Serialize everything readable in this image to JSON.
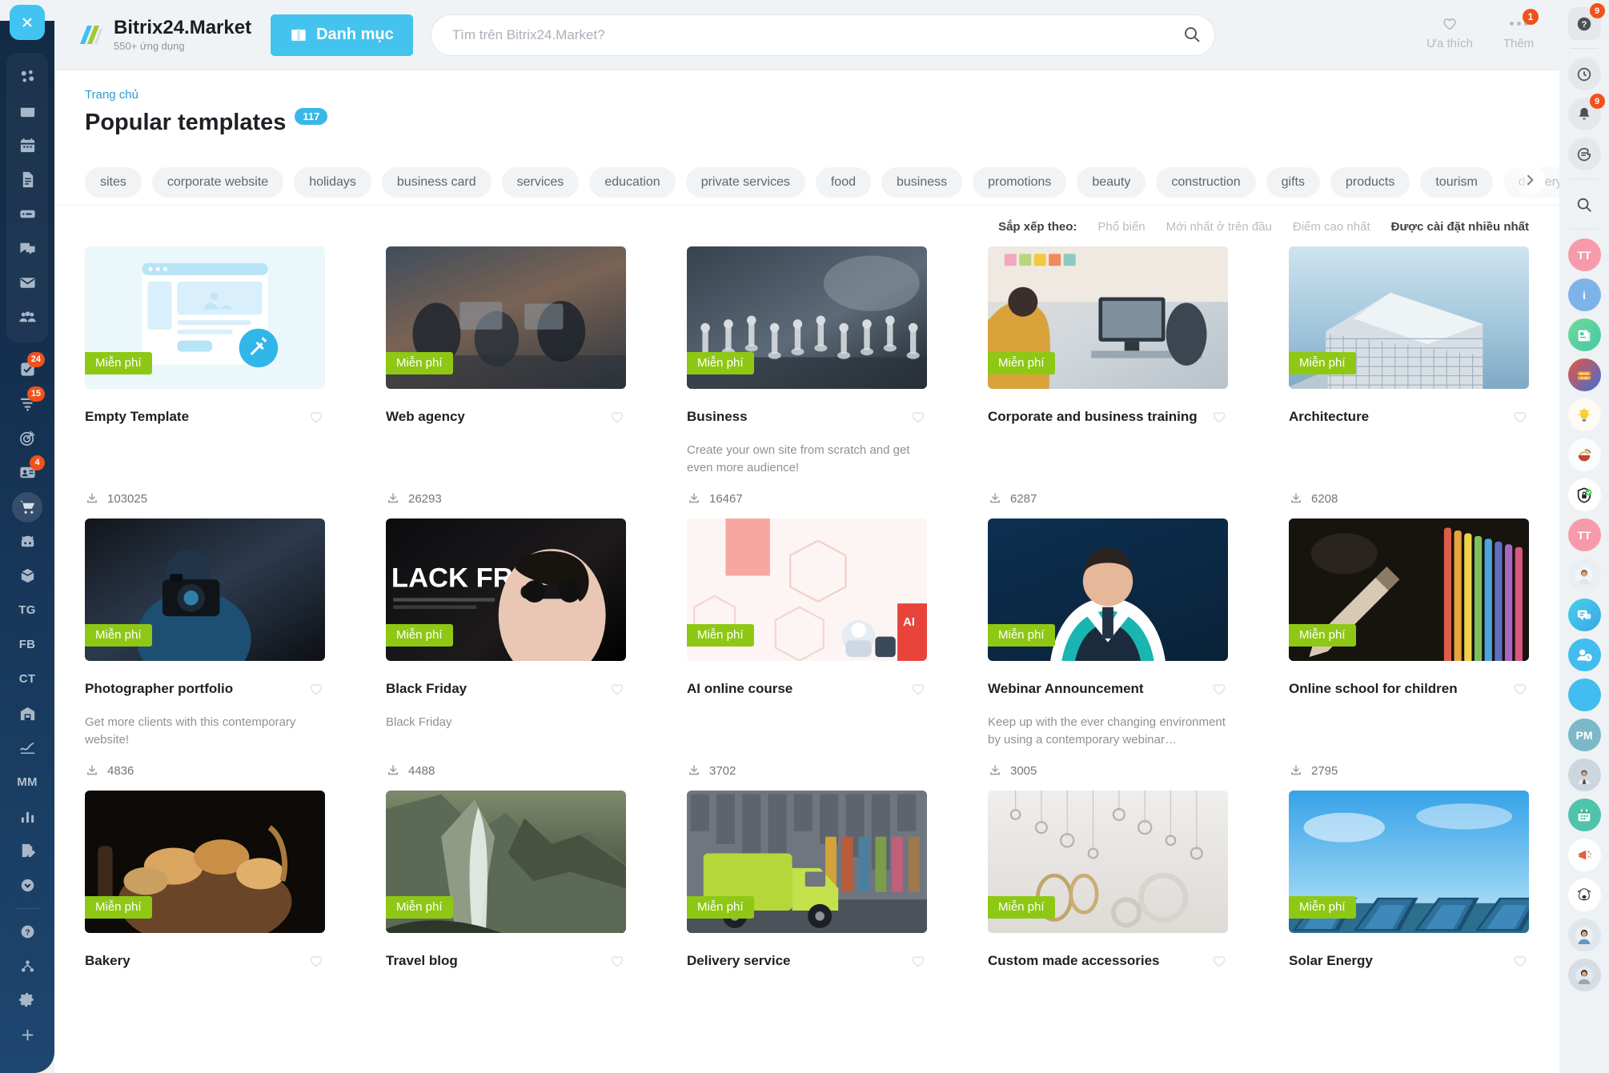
{
  "header": {
    "logo_title": "Bitrix24.Market",
    "logo_sub": "550+ ứng dụng",
    "catalog_button": "Danh mục",
    "search_placeholder": "Tìm trên Bitrix24.Market?",
    "search_value": "",
    "favorites_label": "Ưa thích",
    "more_label": "Thêm",
    "more_badge": "1"
  },
  "breadcrumb": {
    "home": "Trang chủ"
  },
  "page": {
    "title": "Popular templates",
    "count": "117"
  },
  "tags": [
    "sites",
    "corporate website",
    "holidays",
    "business card",
    "services",
    "education",
    "private services",
    "food",
    "business",
    "promotions",
    "beauty",
    "construction",
    "gifts",
    "products",
    "tourism",
    "delivery"
  ],
  "sort": {
    "label": "Sắp xếp theo:",
    "options": [
      {
        "label": "Phổ biến",
        "active": false
      },
      {
        "label": "Mới nhất ở trên đầu",
        "active": false
      },
      {
        "label": "Điểm cao nhất",
        "active": false
      },
      {
        "label": "Được cài đặt nhiều nhất",
        "active": true
      }
    ]
  },
  "free_badge": "Miễn phí",
  "cards": [
    {
      "title": "Empty Template",
      "desc": "",
      "downloads": "103025",
      "badge": "Miễn phí",
      "thumb": "empty-template"
    },
    {
      "title": "Web agency",
      "desc": "",
      "downloads": "26293",
      "badge": "Miễn phí",
      "thumb": "web-agency"
    },
    {
      "title": "Business",
      "desc": "Create your own site from scratch and get even more audience!",
      "downloads": "16467",
      "badge": "Miễn phí",
      "thumb": "business"
    },
    {
      "title": "Corporate and business training",
      "desc": "",
      "downloads": "6287",
      "badge": "Miễn phí",
      "thumb": "corporate-training"
    },
    {
      "title": "Architecture",
      "desc": "",
      "downloads": "6208",
      "badge": "Miễn phí",
      "thumb": "architecture"
    },
    {
      "title": "Photographer portfolio",
      "desc": "Get more clients with this contemporary website!",
      "downloads": "4836",
      "badge": "Miễn phí",
      "thumb": "photographer"
    },
    {
      "title": "Black Friday",
      "desc": "Black Friday",
      "downloads": "4488",
      "badge": "Miễn phí",
      "thumb": "black-friday"
    },
    {
      "title": "AI online course",
      "desc": "",
      "downloads": "3702",
      "badge": "Miễn phí",
      "thumb": "ai-course"
    },
    {
      "title": "Webinar Announcement",
      "desc": "Keep up with the ever changing environment by using a contemporary webinar…",
      "downloads": "3005",
      "badge": "Miễn phí",
      "thumb": "webinar"
    },
    {
      "title": "Online school for children",
      "desc": "",
      "downloads": "2795",
      "badge": "Miễn phí",
      "thumb": "online-school"
    },
    {
      "title": "Bakery",
      "desc": "",
      "downloads": "",
      "badge": "Miễn phí",
      "thumb": "bakery"
    },
    {
      "title": "Travel blog",
      "desc": "",
      "downloads": "",
      "badge": "Miễn phí",
      "thumb": "travel-blog"
    },
    {
      "title": "Delivery service",
      "desc": "",
      "downloads": "",
      "badge": "Miễn phí",
      "thumb": "delivery"
    },
    {
      "title": "Custom made accessories",
      "desc": "",
      "downloads": "",
      "badge": "Miễn phí",
      "thumb": "accessories"
    },
    {
      "title": "Solar Energy",
      "desc": "",
      "downloads": "",
      "badge": "Miễn phí",
      "thumb": "solar"
    }
  ],
  "left_sidebar": {
    "close_icon": "close-icon",
    "group": [
      {
        "name": "network-icon",
        "badge": ""
      },
      {
        "name": "feed-icon",
        "badge": ""
      },
      {
        "name": "calendar-icon",
        "badge": ""
      },
      {
        "name": "document-icon",
        "badge": ""
      },
      {
        "name": "drive-icon",
        "badge": ""
      },
      {
        "name": "chat-icon",
        "badge": ""
      },
      {
        "name": "mail-icon",
        "badge": ""
      },
      {
        "name": "group-icon",
        "badge": ""
      }
    ],
    "items": [
      {
        "name": "tasks-icon",
        "badge": "24",
        "text": ""
      },
      {
        "name": "funnel-icon",
        "badge": "15",
        "text": ""
      },
      {
        "name": "target-icon",
        "badge": "",
        "text": ""
      },
      {
        "name": "contacts-icon",
        "badge": "4",
        "text": ""
      },
      {
        "name": "market-cart-icon",
        "badge": "",
        "text": "",
        "active": true
      },
      {
        "name": "bot-icon",
        "badge": "",
        "text": ""
      },
      {
        "name": "box-icon",
        "badge": "",
        "text": ""
      },
      {
        "name": "tg-label",
        "badge": "",
        "text": "TG"
      },
      {
        "name": "fb-label",
        "badge": "",
        "text": "FB"
      },
      {
        "name": "ct-label",
        "badge": "",
        "text": "CT"
      },
      {
        "name": "warehouse-icon",
        "badge": "",
        "text": ""
      },
      {
        "name": "signature-icon",
        "badge": "",
        "text": ""
      },
      {
        "name": "mm-label",
        "badge": "",
        "text": "MM"
      },
      {
        "name": "analytics-icon",
        "badge": "",
        "text": ""
      },
      {
        "name": "report-edit-icon",
        "badge": "",
        "text": ""
      },
      {
        "name": "chevron-down-circle-icon",
        "badge": "",
        "text": ""
      }
    ],
    "bottom": [
      {
        "name": "help-circle-icon"
      },
      {
        "name": "sitemap-icon"
      },
      {
        "name": "gear-icon"
      },
      {
        "name": "plus-icon"
      }
    ]
  },
  "right_sidebar": {
    "items": [
      {
        "name": "help-question-icon",
        "badge": "9",
        "kind": "square-gray",
        "label": "?"
      },
      {
        "sep": true
      },
      {
        "name": "activity-icon",
        "badge": "",
        "kind": "circle-gray",
        "label": ""
      },
      {
        "name": "notifications-bell-icon",
        "badge": "9",
        "kind": "circle-gray",
        "label": ""
      },
      {
        "name": "chat-messages-icon",
        "badge": "",
        "kind": "circle-gray",
        "label": ""
      },
      {
        "sep": true
      },
      {
        "name": "search-icon",
        "badge": "",
        "kind": "plain",
        "label": ""
      },
      {
        "sep": true
      },
      {
        "name": "avatar-tt-pink",
        "badge": "",
        "kind": "avatar-pink",
        "label": "TT"
      },
      {
        "name": "info-icon",
        "badge": "",
        "kind": "avatar-blue",
        "label": "i"
      },
      {
        "name": "news-icon",
        "badge": "",
        "kind": "avatar-green",
        "label": ""
      },
      {
        "name": "book-club-icon",
        "badge": "",
        "kind": "avatar-bookclub",
        "label": ""
      },
      {
        "name": "idea-bulb-icon",
        "badge": "",
        "kind": "avatar-bulb",
        "label": ""
      },
      {
        "name": "noodles-icon",
        "badge": "",
        "kind": "avatar-noodles",
        "label": ""
      },
      {
        "name": "security-shield-icon",
        "badge": "",
        "kind": "avatar-shield",
        "label": ""
      },
      {
        "name": "avatar-tt-pink-2",
        "badge": "",
        "kind": "avatar-pink",
        "label": "TT"
      },
      {
        "name": "avatar-person-1",
        "badge": "",
        "kind": "avatar-photo-a",
        "label": ""
      },
      {
        "name": "chat-bubbles-icon",
        "badge": "",
        "kind": "avatar-chat",
        "label": ""
      },
      {
        "name": "user-clock-icon",
        "badge": "",
        "kind": "avatar-userclock",
        "label": ""
      },
      {
        "name": "user-clock-icon-2",
        "badge": "",
        "kind": "avatar-userclock",
        "label": ""
      },
      {
        "name": "avatar-pm",
        "badge": "",
        "kind": "avatar-pm",
        "label": "PM"
      },
      {
        "name": "avatar-person-2",
        "badge": "",
        "kind": "avatar-photo-b",
        "label": ""
      },
      {
        "name": "calendar-green-icon",
        "badge": "",
        "kind": "avatar-calendar",
        "label": ""
      },
      {
        "name": "megaphone-icon",
        "badge": "",
        "kind": "avatar-megaphone",
        "label": ""
      },
      {
        "name": "bear-icon",
        "badge": "",
        "kind": "avatar-bear",
        "label": ""
      },
      {
        "name": "avatar-person-3",
        "badge": "",
        "kind": "avatar-photo-c",
        "label": ""
      },
      {
        "name": "avatar-person-4",
        "badge": "",
        "kind": "avatar-photo-d",
        "label": ""
      }
    ]
  },
  "colors": {
    "accent": "#45c3ef",
    "free_badge": "#8ec815",
    "badge_red": "#f1511b",
    "sidebar_dark": "#15304f"
  }
}
